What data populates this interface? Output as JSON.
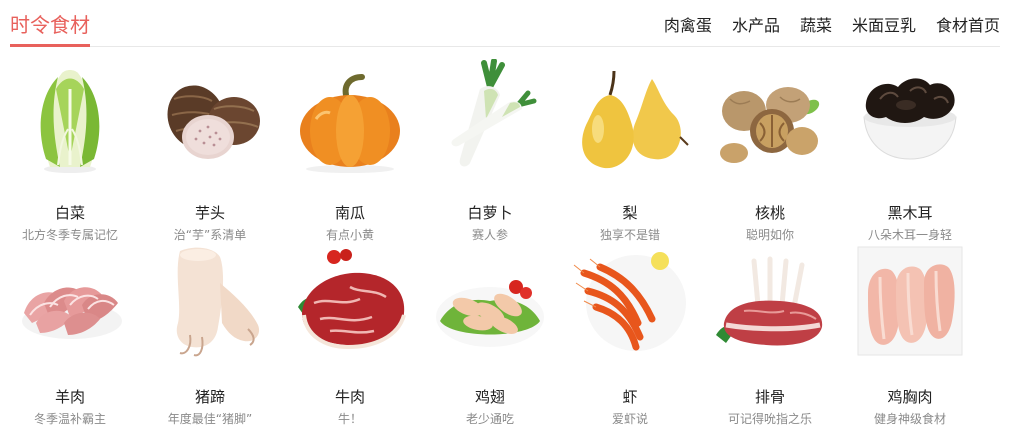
{
  "header": {
    "title": "时令食材",
    "nav": [
      "肉禽蛋",
      "水产品",
      "蔬菜",
      "米面豆乳",
      "食材首页"
    ]
  },
  "items": [
    {
      "name": "白菜",
      "desc": "北方冬季专属记忆",
      "icon": "napa-cabbage-icon"
    },
    {
      "name": "芋头",
      "desc": "治“芋”系清单",
      "icon": "taro-icon"
    },
    {
      "name": "南瓜",
      "desc": "有点小黄",
      "icon": "pumpkin-icon"
    },
    {
      "name": "白萝卜",
      "desc": "赛人参",
      "icon": "white-radish-icon"
    },
    {
      "name": "梨",
      "desc": "独享不是错",
      "icon": "pear-icon"
    },
    {
      "name": "核桃",
      "desc": "聪明如你",
      "icon": "walnut-icon"
    },
    {
      "name": "黑木耳",
      "desc": "八朵木耳一身轻",
      "icon": "black-fungus-icon"
    },
    {
      "name": "羊肉",
      "desc": "冬季温补霸主",
      "icon": "lamb-slices-icon"
    },
    {
      "name": "猪蹄",
      "desc": "年度最佳“猪脚”",
      "icon": "pig-trotter-icon"
    },
    {
      "name": "牛肉",
      "desc": "牛！",
      "icon": "beef-icon"
    },
    {
      "name": "鸡翅",
      "desc": "老少通吃",
      "icon": "chicken-wing-icon"
    },
    {
      "name": "虾",
      "desc": "爱虾说",
      "icon": "shrimp-icon"
    },
    {
      "name": "排骨",
      "desc": "可记得吮指之乐",
      "icon": "ribs-icon"
    },
    {
      "name": "鸡胸肉",
      "desc": "健身神级食材",
      "icon": "chicken-breast-icon"
    }
  ],
  "colors": {
    "accent": "#e8615c",
    "text": "#222222",
    "subtext": "#8a8a8a",
    "divider": "#e8e8e8"
  }
}
